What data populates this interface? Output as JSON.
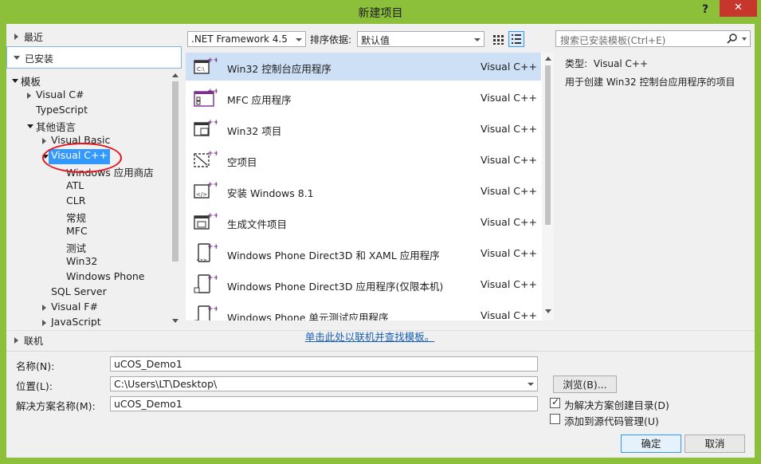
{
  "window": {
    "title": "新建项目",
    "help_label": "?",
    "close_label": "✕"
  },
  "left": {
    "recent_label": "最近",
    "installed_label": "已安装",
    "online_label": "联机",
    "tree": [
      {
        "label": "模板",
        "level": 0,
        "state": "expanded"
      },
      {
        "label": "Visual C#",
        "level": 1,
        "state": "collapsed"
      },
      {
        "label": "TypeScript",
        "level": 1,
        "state": "leaf"
      },
      {
        "label": "其他语言",
        "level": 1,
        "state": "expanded"
      },
      {
        "label": "Visual Basic",
        "level": 2,
        "state": "collapsed"
      },
      {
        "label": "Visual C++",
        "level": 2,
        "state": "expanded",
        "selected": true
      },
      {
        "label": "Windows 应用商店",
        "level": 3,
        "state": "leaf"
      },
      {
        "label": "ATL",
        "level": 3,
        "state": "leaf"
      },
      {
        "label": "CLR",
        "level": 3,
        "state": "leaf"
      },
      {
        "label": "常规",
        "level": 3,
        "state": "leaf"
      },
      {
        "label": "MFC",
        "level": 3,
        "state": "leaf"
      },
      {
        "label": "测试",
        "level": 3,
        "state": "leaf"
      },
      {
        "label": "Win32",
        "level": 3,
        "state": "leaf"
      },
      {
        "label": "Windows Phone",
        "level": 3,
        "state": "leaf"
      },
      {
        "label": "SQL Server",
        "level": 2,
        "state": "leaf"
      },
      {
        "label": "Visual F#",
        "level": 2,
        "state": "collapsed"
      },
      {
        "label": "JavaScript",
        "level": 2,
        "state": "collapsed"
      }
    ]
  },
  "toolbar": {
    "framework": ".NET Framework 4.5",
    "sort_label": "排序依据:",
    "sort_value": "默认值"
  },
  "templates": [
    {
      "name": "Win32 控制台应用程序",
      "lang": "Visual C++",
      "icon": "console-app-icon",
      "selected": true
    },
    {
      "name": "MFC 应用程序",
      "lang": "Visual C++",
      "icon": "mfc-app-icon"
    },
    {
      "name": "Win32 项目",
      "lang": "Visual C++",
      "icon": "win32-project-icon"
    },
    {
      "name": "空项目",
      "lang": "Visual C++",
      "icon": "empty-project-icon"
    },
    {
      "name": "安装 Windows 8.1",
      "lang": "Visual C++",
      "icon": "install-windows-icon"
    },
    {
      "name": "生成文件项目",
      "lang": "Visual C++",
      "icon": "makefile-project-icon"
    },
    {
      "name": "Windows Phone Direct3D 和 XAML 应用程序",
      "lang": "Visual C++",
      "icon": "phone-xaml-icon"
    },
    {
      "name": "Windows Phone Direct3D 应用程序(仅限本机)",
      "lang": "Visual C++",
      "icon": "phone-d3d-icon"
    },
    {
      "name": "Windows Phone 单元测试应用程序",
      "lang": "Visual C++",
      "icon": "phone-test-icon"
    }
  ],
  "online_link": "单击此处以联机并查找模板。",
  "search": {
    "placeholder": "搜索已安装模板(Ctrl+E)"
  },
  "info": {
    "type_label": "类型:",
    "type_value": "Visual C++",
    "description": "用于创建 Win32 控制台应用程序的项目"
  },
  "form": {
    "name_label": "名称(N):",
    "name_value": "uCOS_Demo1",
    "location_label": "位置(L):",
    "location_value": "C:\\Users\\LT\\Desktop\\",
    "solution_label": "解决方案名称(M):",
    "solution_value": "uCOS_Demo1",
    "browse_label": "浏览(B)...",
    "create_dir_label": "为解决方案创建目录(D)",
    "create_dir_checked": true,
    "source_control_label": "添加到源代码管理(U)",
    "source_control_checked": false,
    "ok_label": "确定",
    "cancel_label": "取消"
  },
  "colors": {
    "frame": "#8cbf3a",
    "selection": "#3399ff",
    "template_selection": "#cde0f5",
    "close": "#c7362c",
    "annotation": "#e5131e"
  }
}
